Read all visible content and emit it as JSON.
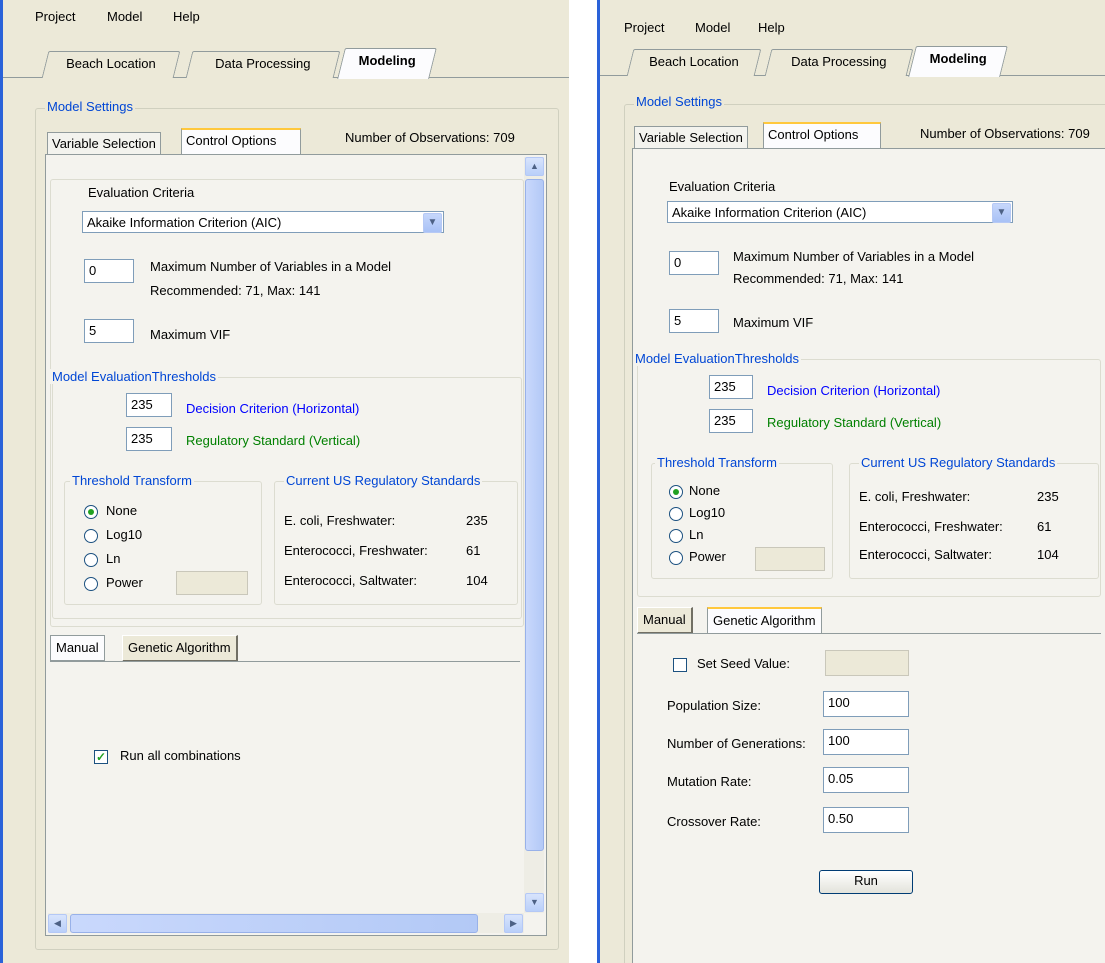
{
  "menu": [
    "Project",
    "Model",
    "Help"
  ],
  "main_tabs": [
    "Beach Location",
    "Data Processing",
    "Modeling"
  ],
  "model_settings": {
    "title": "Model Settings",
    "tab_variable_selection": "Variable Selection",
    "tab_control_options": "Control Options",
    "observations": "Number of Observations: 709"
  },
  "evaluation": {
    "label": "Evaluation Criteria",
    "selected": "Akaike Information Criterion (AIC)",
    "max_vars_value": "0",
    "max_vars_label": "Maximum Number of Variables in a Model",
    "max_vars_recommended": "Recommended: 71, Max: 141",
    "vif_value": "5",
    "vif_label": "Maximum VIF"
  },
  "thresholds": {
    "title": "Model EvaluationThresholds",
    "decision_value": "235",
    "decision_label": "Decision Criterion (Horizontal)",
    "regulatory_value": "235",
    "regulatory_label": "Regulatory Standard (Vertical)"
  },
  "transform": {
    "title": "Threshold Transform",
    "options": [
      "None",
      "Log10",
      "Ln",
      "Power"
    ],
    "selected": "None"
  },
  "standards": {
    "title": "Current US Regulatory Standards",
    "rows": [
      {
        "name": "E. coli, Freshwater:",
        "value": "235"
      },
      {
        "name": "Enterococci, Freshwater:",
        "value": "61"
      },
      {
        "name": "Enterococci, Saltwater:",
        "value": "104"
      }
    ]
  },
  "method_tabs": [
    "Manual",
    "Genetic Algorithm"
  ],
  "manual": {
    "run_all_label": "Run all combinations",
    "run_all_checked": true
  },
  "genetic": {
    "seed_label": "Set Seed Value:",
    "seed_checked": false,
    "population_label": "Population Size:",
    "population_value": "100",
    "generations_label": "Number of Generations:",
    "generations_value": "100",
    "mutation_label": "Mutation Rate:",
    "mutation_value": "0.05",
    "crossover_label": "Crossover Rate:",
    "crossover_value": "0.50",
    "run_label": "Run"
  },
  "colors": {
    "accent_blue": "#0046d5",
    "decision_blue": "#0000ff",
    "regulatory_green": "#008000",
    "window_bg": "#ece9d8"
  }
}
